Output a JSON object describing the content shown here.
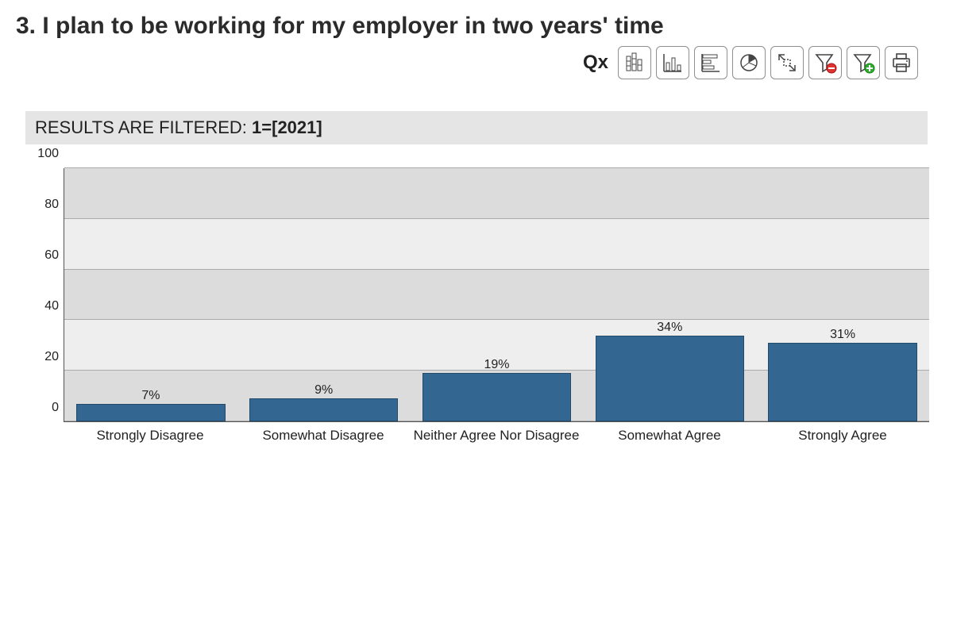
{
  "question": {
    "number": "3.",
    "text": "I plan to be working for my employer in two years' time"
  },
  "toolbar": {
    "qx": "Qx"
  },
  "filter": {
    "prefix": "RESULTS ARE FILTERED: ",
    "strong": "1=[2021]"
  },
  "chart_data": {
    "type": "bar",
    "title": "",
    "xlabel": "",
    "ylabel": "",
    "ylim": [
      0,
      100
    ],
    "yticks": [
      0,
      20,
      40,
      60,
      80,
      100
    ],
    "categories": [
      "Strongly Disagree",
      "Somewhat Disagree",
      "Neither Agree Nor Disagree",
      "Somewhat Agree",
      "Strongly Agree"
    ],
    "values": [
      7,
      9,
      19,
      34,
      31
    ],
    "value_labels": [
      "7%",
      "9%",
      "19%",
      "34%",
      "31%"
    ],
    "bar_color": "#336690"
  }
}
